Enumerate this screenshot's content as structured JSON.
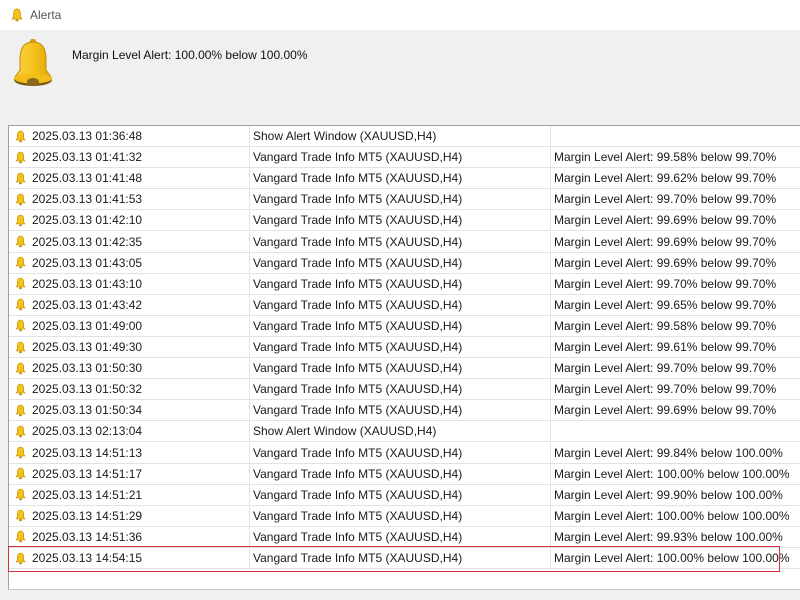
{
  "window": {
    "title": "Alerta"
  },
  "alert": {
    "message": "Margin Level Alert: 100.00% below 100.00%"
  },
  "rows": [
    {
      "time": "2025.03.13 01:36:48",
      "source": "Show Alert Window (XAUUSD,H4)",
      "message": ""
    },
    {
      "time": "2025.03.13 01:41:32",
      "source": "Vangard Trade Info MT5 (XAUUSD,H4)",
      "message": "Margin Level Alert: 99.58% below 99.70%"
    },
    {
      "time": "2025.03.13 01:41:48",
      "source": "Vangard Trade Info MT5 (XAUUSD,H4)",
      "message": "Margin Level Alert: 99.62% below 99.70%"
    },
    {
      "time": "2025.03.13 01:41:53",
      "source": "Vangard Trade Info MT5 (XAUUSD,H4)",
      "message": "Margin Level Alert: 99.70% below 99.70%"
    },
    {
      "time": "2025.03.13 01:42:10",
      "source": "Vangard Trade Info MT5 (XAUUSD,H4)",
      "message": "Margin Level Alert: 99.69% below 99.70%"
    },
    {
      "time": "2025.03.13 01:42:35",
      "source": "Vangard Trade Info MT5 (XAUUSD,H4)",
      "message": "Margin Level Alert: 99.69% below 99.70%"
    },
    {
      "time": "2025.03.13 01:43:05",
      "source": "Vangard Trade Info MT5 (XAUUSD,H4)",
      "message": "Margin Level Alert: 99.69% below 99.70%"
    },
    {
      "time": "2025.03.13 01:43:10",
      "source": "Vangard Trade Info MT5 (XAUUSD,H4)",
      "message": "Margin Level Alert: 99.70% below 99.70%"
    },
    {
      "time": "2025.03.13 01:43:42",
      "source": "Vangard Trade Info MT5 (XAUUSD,H4)",
      "message": "Margin Level Alert: 99.65% below 99.70%"
    },
    {
      "time": "2025.03.13 01:49:00",
      "source": "Vangard Trade Info MT5 (XAUUSD,H4)",
      "message": "Margin Level Alert: 99.58% below 99.70%"
    },
    {
      "time": "2025.03.13 01:49:30",
      "source": "Vangard Trade Info MT5 (XAUUSD,H4)",
      "message": "Margin Level Alert: 99.61% below 99.70%"
    },
    {
      "time": "2025.03.13 01:50:30",
      "source": "Vangard Trade Info MT5 (XAUUSD,H4)",
      "message": "Margin Level Alert: 99.70% below 99.70%"
    },
    {
      "time": "2025.03.13 01:50:32",
      "source": "Vangard Trade Info MT5 (XAUUSD,H4)",
      "message": "Margin Level Alert: 99.70% below 99.70%"
    },
    {
      "time": "2025.03.13 01:50:34",
      "source": "Vangard Trade Info MT5 (XAUUSD,H4)",
      "message": "Margin Level Alert: 99.69% below 99.70%"
    },
    {
      "time": "2025.03.13 02:13:04",
      "source": "Show Alert Window (XAUUSD,H4)",
      "message": ""
    },
    {
      "time": "2025.03.13 14:51:13",
      "source": "Vangard Trade Info MT5 (XAUUSD,H4)",
      "message": "Margin Level Alert: 99.84% below 100.00%"
    },
    {
      "time": "2025.03.13 14:51:17",
      "source": "Vangard Trade Info MT5 (XAUUSD,H4)",
      "message": "Margin Level Alert: 100.00% below 100.00%"
    },
    {
      "time": "2025.03.13 14:51:21",
      "source": "Vangard Trade Info MT5 (XAUUSD,H4)",
      "message": "Margin Level Alert: 99.90% below 100.00%"
    },
    {
      "time": "2025.03.13 14:51:29",
      "source": "Vangard Trade Info MT5 (XAUUSD,H4)",
      "message": "Margin Level Alert: 100.00% below 100.00%"
    },
    {
      "time": "2025.03.13 14:51:36",
      "source": "Vangard Trade Info MT5 (XAUUSD,H4)",
      "message": "Margin Level Alert: 99.93% below 100.00%"
    },
    {
      "time": "2025.03.13 14:54:15",
      "source": "Vangard Trade Info MT5 (XAUUSD,H4)",
      "message": "Margin Level Alert: 100.00% below 100.00%"
    }
  ],
  "selected_row": 20,
  "colors": {
    "bell": "#f5c21b",
    "highlight_border": "#d4323a"
  }
}
